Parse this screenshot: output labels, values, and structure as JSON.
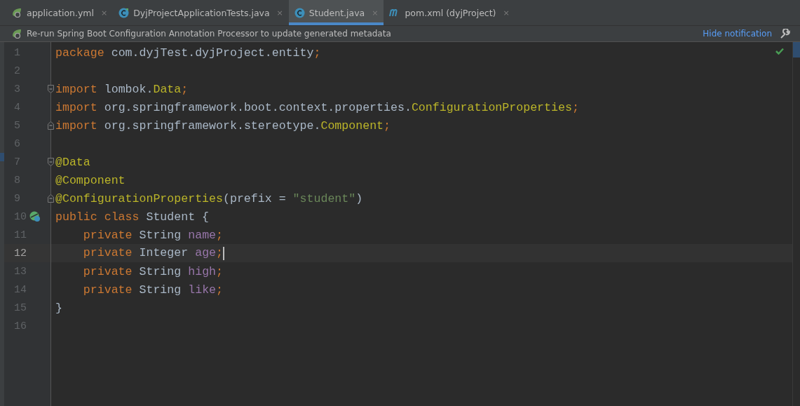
{
  "tabs": [
    {
      "label": "application.yml",
      "icon": {
        "kind": "spring"
      },
      "close": "×",
      "selected": false
    },
    {
      "label": "DyjProjectApplicationTests.java",
      "icon": {
        "kind": "testclass"
      },
      "close": "×",
      "selected": false
    },
    {
      "label": "Student.java",
      "icon": {
        "kind": "class"
      },
      "close": "×",
      "selected": true
    },
    {
      "label": "pom.xml (dyjProject)",
      "icon": {
        "kind": "maven"
      },
      "close": "×",
      "selected": false
    }
  ],
  "notification": {
    "text": "Re-run Spring Boot Configuration Annotation Processor to update generated metadata",
    "action": "Hide notification"
  },
  "editor": {
    "lines": [
      {
        "number": "1",
        "current": false,
        "tokens": [
          {
            "text": "package ",
            "kind": "keyword"
          },
          {
            "text": "com.dyjTest.dyjProject.entity",
            "kind": "plain"
          },
          {
            "text": ";",
            "kind": "keyword"
          }
        ]
      },
      {
        "number": "2",
        "current": false
      },
      {
        "number": "3",
        "current": false,
        "fold": {
          "kind": "start"
        },
        "tokens": [
          {
            "text": "import ",
            "kind": "keyword"
          },
          {
            "text": "lombok.",
            "kind": "plain"
          },
          {
            "text": "Data",
            "kind": "annotation"
          },
          {
            "text": ";",
            "kind": "keyword"
          }
        ]
      },
      {
        "number": "4",
        "current": false,
        "tokens": [
          {
            "text": "import ",
            "kind": "keyword"
          },
          {
            "text": "org.springframework.boot.context.properties.",
            "kind": "plain"
          },
          {
            "text": "ConfigurationProperties",
            "kind": "annotation"
          },
          {
            "text": ";",
            "kind": "keyword"
          }
        ]
      },
      {
        "number": "5",
        "current": false,
        "fold": {
          "kind": "end"
        },
        "tokens": [
          {
            "text": "import ",
            "kind": "keyword"
          },
          {
            "text": "org.springframework.stereotype.",
            "kind": "plain"
          },
          {
            "text": "Component",
            "kind": "annotation"
          },
          {
            "text": ";",
            "kind": "keyword"
          }
        ]
      },
      {
        "number": "6",
        "current": false
      },
      {
        "number": "7",
        "current": false,
        "fold": {
          "kind": "start"
        },
        "tokens": [
          {
            "text": "@Data",
            "kind": "annotation"
          }
        ]
      },
      {
        "number": "8",
        "current": false,
        "tokens": [
          {
            "text": "@Component",
            "kind": "annotation"
          }
        ]
      },
      {
        "number": "9",
        "current": false,
        "fold": {
          "kind": "end"
        },
        "tokens": [
          {
            "text": "@ConfigurationProperties",
            "kind": "annotation"
          },
          {
            "text": "(prefix = ",
            "kind": "plain"
          },
          {
            "text": "\"student\"",
            "kind": "string"
          },
          {
            "text": ")",
            "kind": "plain"
          }
        ]
      },
      {
        "number": "10",
        "current": false,
        "gutter_icon": {
          "kind": "bean"
        },
        "tokens": [
          {
            "text": "public class ",
            "kind": "keyword"
          },
          {
            "text": "Student {",
            "kind": "plain"
          }
        ]
      },
      {
        "number": "11",
        "current": false,
        "tokens": [
          {
            "text": "    private ",
            "kind": "keyword"
          },
          {
            "text": "String ",
            "kind": "plain"
          },
          {
            "text": "name",
            "kind": "field"
          },
          {
            "text": ";",
            "kind": "keyword"
          }
        ]
      },
      {
        "number": "12",
        "current": true,
        "tokens": [
          {
            "text": "    private ",
            "kind": "keyword"
          },
          {
            "text": "Integer ",
            "kind": "plain"
          },
          {
            "text": "age",
            "kind": "field"
          },
          {
            "text": ";",
            "kind": "keyword"
          }
        ]
      },
      {
        "number": "13",
        "current": false,
        "tokens": [
          {
            "text": "    private ",
            "kind": "keyword"
          },
          {
            "text": "String ",
            "kind": "plain"
          },
          {
            "text": "high",
            "kind": "field"
          },
          {
            "text": ";",
            "kind": "keyword"
          }
        ]
      },
      {
        "number": "14",
        "current": false,
        "tokens": [
          {
            "text": "    private ",
            "kind": "keyword"
          },
          {
            "text": "String ",
            "kind": "plain"
          },
          {
            "text": "like",
            "kind": "field"
          },
          {
            "text": ";",
            "kind": "keyword"
          }
        ]
      },
      {
        "number": "15",
        "current": false,
        "tokens": [
          {
            "text": "}",
            "kind": "plain"
          }
        ]
      },
      {
        "number": "16",
        "current": false
      }
    ]
  }
}
